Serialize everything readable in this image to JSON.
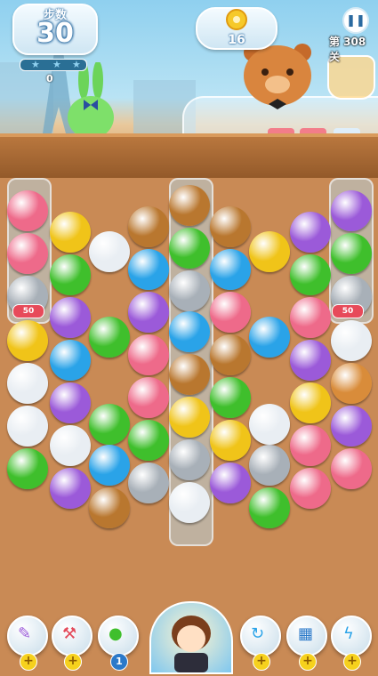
{
  "hud": {
    "moves_label": "步数",
    "moves_left": "30",
    "score": "0",
    "goal_count": "16",
    "goal_icon": "pineapple-ring-icon",
    "level_label": "第 308 关"
  },
  "board": {
    "colors": {
      "brown": "#b9772f",
      "green": "#3fbf2c",
      "blue": "#2aa3e8",
      "silver": "#a8b0b8",
      "purple": "#9b5ad9",
      "pink": "#ee6a8a",
      "yellow": "#f0c419",
      "white": "#e9eef3",
      "orange": "#d98c3a"
    },
    "special_badges": [
      "50",
      "50"
    ]
  },
  "toolbar": {
    "tools": [
      {
        "icon": "wand-icon",
        "badge": "+"
      },
      {
        "icon": "hammer-icon",
        "badge": "+"
      },
      {
        "icon": "balloon-icon",
        "badge": "1"
      },
      {
        "icon": "swap-arrow-icon",
        "badge": "+"
      },
      {
        "icon": "grid-shuffle-icon",
        "badge": "+"
      },
      {
        "icon": "lightning-icon",
        "badge": "+"
      }
    ]
  }
}
